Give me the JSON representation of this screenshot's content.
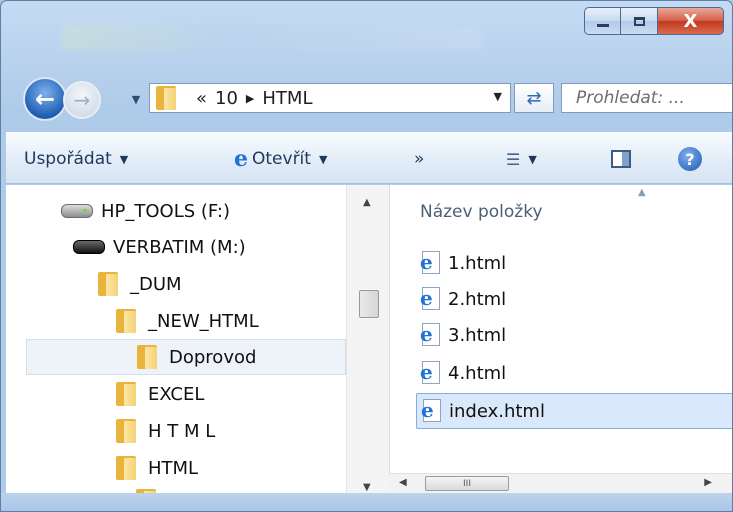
{
  "window": {
    "close_symbol": "X"
  },
  "address": {
    "prefix": "«",
    "crumbs": [
      "10",
      "HTML"
    ]
  },
  "search": {
    "placeholder": "Prohledat: ..."
  },
  "toolbar": {
    "organize_label": "Uspořádat",
    "open_label": "Otevřít",
    "more_label": "»"
  },
  "tree": {
    "items": [
      {
        "label": "HP_TOOLS (F:)",
        "icon": "drive-icon"
      },
      {
        "label": "VERBATIM (M:)",
        "icon": "drive-icon"
      },
      {
        "label": "_DUM",
        "icon": "folder-icon"
      },
      {
        "label": "_NEW_HTML",
        "icon": "folder-icon"
      },
      {
        "label": "Doprovod",
        "icon": "folder-icon",
        "selected": true
      },
      {
        "label": "EXCEL",
        "icon": "folder-icon"
      },
      {
        "label": "H T M L",
        "icon": "folder-icon"
      },
      {
        "label": "HTML",
        "icon": "folder-icon"
      }
    ]
  },
  "files": {
    "column_header": "Název položky",
    "items": [
      {
        "name": "1.html"
      },
      {
        "name": "2.html"
      },
      {
        "name": "3.html"
      },
      {
        "name": "4.html"
      },
      {
        "name": "index.html",
        "selected": true
      }
    ]
  },
  "hscroll": {
    "thumb_grip": "III"
  },
  "colors": {
    "accent": "#1f5fb4",
    "selection": "#d9e8fb",
    "close_button": "#c13a20"
  }
}
